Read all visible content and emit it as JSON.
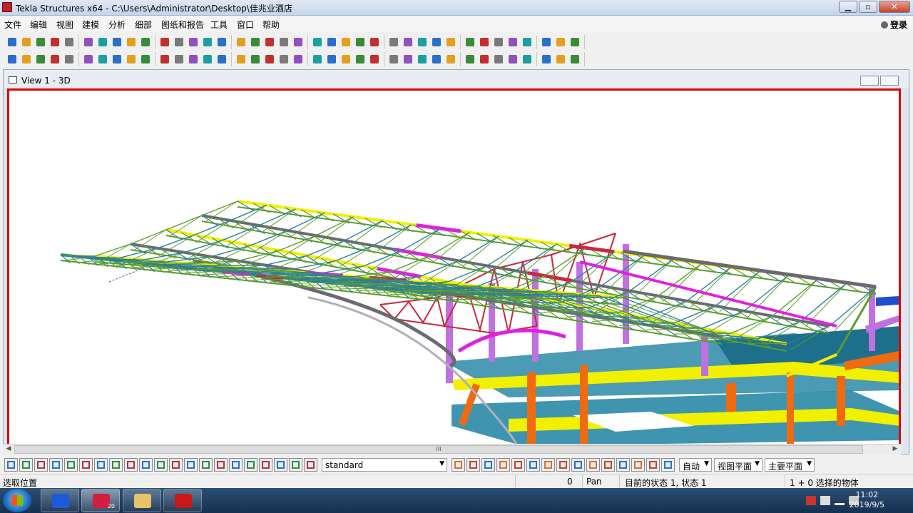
{
  "window": {
    "title": "Tekla Structures x64 - C:\\Users\\Administrator\\Desktop\\佳兆业酒店",
    "minimize_glyph": "▁",
    "maximize_glyph": "▫",
    "close_glyph": "✕"
  },
  "menu": {
    "items": [
      "文件",
      "编辑",
      "视图",
      "建模",
      "分析",
      "细部",
      "图纸和报告",
      "工具",
      "窗口",
      "帮助"
    ],
    "login_label": "登录"
  },
  "view": {
    "title": "View 1 - 3D"
  },
  "scrollbar": {
    "left_glyph": "◀",
    "right_glyph": "▶",
    "thumb_glyph": "III"
  },
  "bottom_toolbar": {
    "standard_select": "standard",
    "auto_select": "自动",
    "view_plane_select": "视图平面",
    "main_plane_select": "主要平面"
  },
  "statusbar": {
    "prompt": "选取位置",
    "count": "0",
    "mode": "Pan",
    "state": "目前的状态 1, 状态 1",
    "selection": "1 + 0 选择的物体"
  },
  "taskbar": {
    "time": "11:02",
    "date": "2019/9/5",
    "tekla_badge": "20"
  },
  "icons": {
    "toolbar_row1": [
      "new-icon",
      "open-icon",
      "save-icon",
      "undo-icon",
      "redo-icon",
      "copy-icon",
      "paste-icon",
      "print-icon",
      "properties-icon",
      "view-icon",
      "view-icon",
      "view-icon",
      "cut-icon",
      "select-icon",
      "model-icon",
      "model-icon",
      "model-icon",
      "model-icon",
      "snap-icon",
      "snap-icon",
      "grid-icon",
      "grid-icon",
      "help-icon",
      "dim-icon",
      "dim-icon",
      "dim-icon",
      "dim-icon",
      "dim-icon",
      "dim-icon",
      "tool-icon",
      "copy-icon",
      "move-icon",
      "rotate-icon",
      "mirror-icon",
      "tekla-icon",
      "next-icon",
      "filter-icon",
      "layer-icon"
    ],
    "toolbar_row2": [
      "component-icon",
      "component-icon",
      "column-icon",
      "beam-icon",
      "beam-icon",
      "plate-icon",
      "plate-icon",
      "bolt-icon",
      "weld-icon",
      "cut-icon",
      "column-icon",
      "beam-icon",
      "beam-icon",
      "beam-icon",
      "beam-icon",
      "beam-icon",
      "detail-icon",
      "detail-icon",
      "binoculars-icon",
      "connection-icon",
      "connection-icon",
      "connection-icon",
      "part-icon",
      "part-icon",
      "part-icon",
      "part-icon",
      "part-icon",
      "part-icon",
      "part-icon",
      "part-icon",
      "line-icon",
      "line-icon",
      "line-icon",
      "line-icon",
      "line-icon",
      "line-icon",
      "line-icon",
      "circle-icon"
    ]
  },
  "colors": {
    "accent_red": "#e00000",
    "truss_green": "#5a9e2a",
    "truss_yellow": "#f0f000",
    "truss_magenta": "#e020e0",
    "truss_gray": "#6a6a72",
    "truss_teal": "#2a7f9e",
    "slab_teal": "#2a8aa6",
    "column_orange": "#f06a10",
    "column_violet": "#c070e0",
    "truss_red": "#c8283c"
  }
}
